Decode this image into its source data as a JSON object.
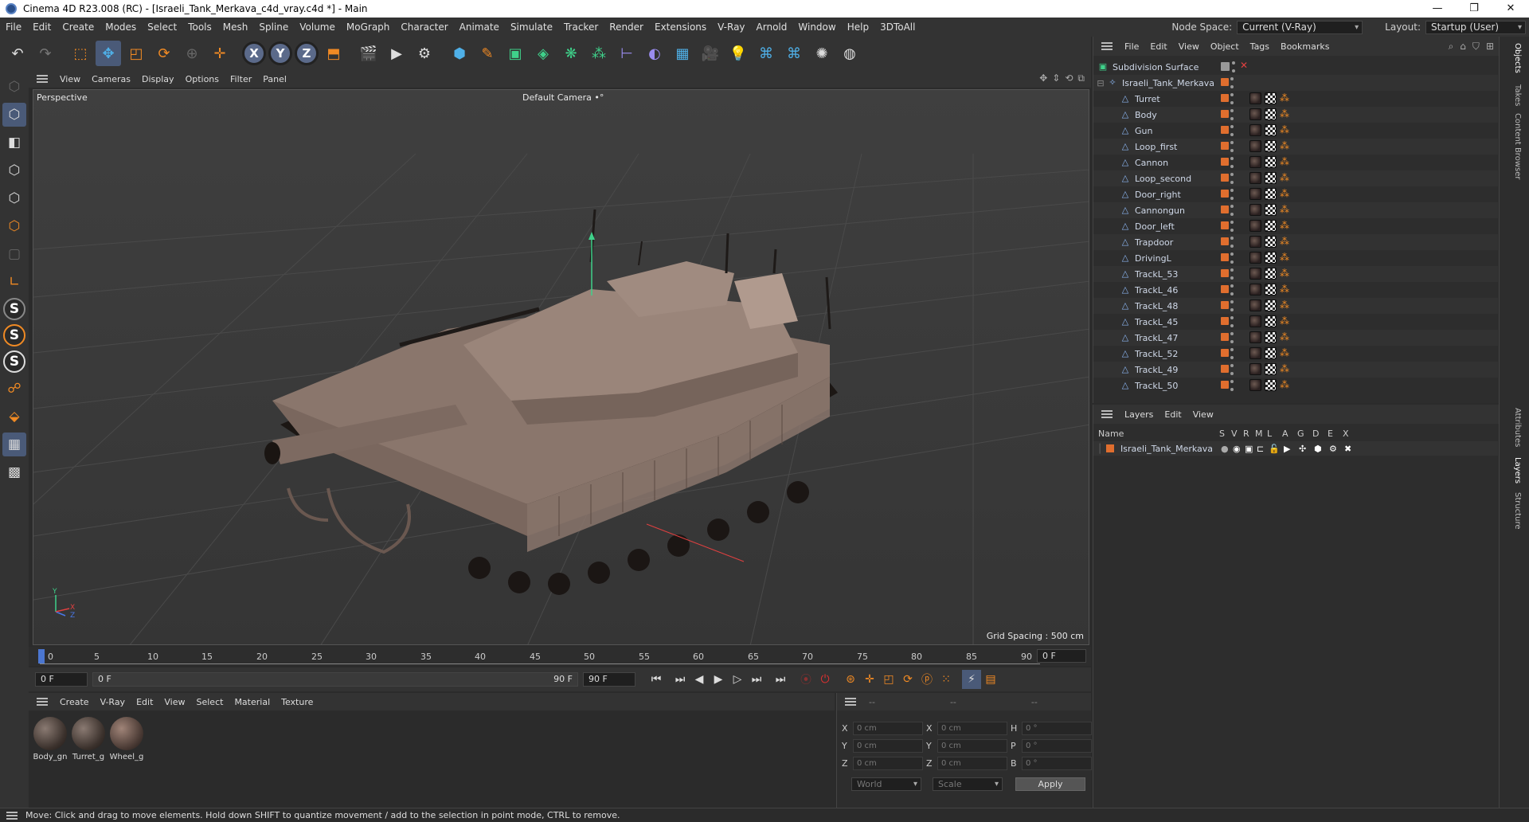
{
  "window": {
    "title": "Cinema 4D R23.008 (RC) - [Israeli_Tank_Merkava_c4d_vray.c4d *] - Main",
    "controls": [
      "—",
      "❐",
      "✕"
    ]
  },
  "menubar": {
    "items": [
      "File",
      "Edit",
      "Create",
      "Modes",
      "Select",
      "Tools",
      "Mesh",
      "Spline",
      "Volume",
      "MoGraph",
      "Character",
      "Animate",
      "Simulate",
      "Tracker",
      "Render",
      "Extensions",
      "V-Ray",
      "Arnold",
      "Window",
      "Help",
      "3DToAll"
    ],
    "node_space_label": "Node Space:",
    "node_space_value": "Current (V-Ray)",
    "layout_label": "Layout:",
    "layout_value": "Startup (User)"
  },
  "toolbar": {
    "x_label": "X",
    "y_label": "Y",
    "z_label": "Z"
  },
  "viewport": {
    "menu": [
      "View",
      "Cameras",
      "Display",
      "Options",
      "Filter",
      "Panel"
    ],
    "view_name": "Perspective",
    "camera_name": "Default Camera",
    "camera_mark": "•°",
    "grid_spacing": "Grid Spacing : 500 cm",
    "axis_y": "Y",
    "axis_z": "Z",
    "axis_x": "X"
  },
  "timeline": {
    "ticks": [
      "0",
      "5",
      "10",
      "15",
      "20",
      "25",
      "30",
      "35",
      "40",
      "45",
      "50",
      "55",
      "60",
      "65",
      "70",
      "75",
      "80",
      "85",
      "90"
    ],
    "current_frame": "0 F"
  },
  "transport": {
    "start_field": "0 F",
    "range_start": "0 F",
    "range_end": "90 F",
    "end_field": "90 F"
  },
  "materials": {
    "menu": [
      "Create",
      "V-Ray",
      "Edit",
      "View",
      "Select",
      "Material",
      "Texture"
    ],
    "items": [
      "Body_gn",
      "Turret_g",
      "Wheel_g"
    ]
  },
  "coordinates": {
    "head": [
      "--",
      "--",
      "--"
    ],
    "rows": [
      {
        "l1": "X",
        "v1": "0 cm",
        "l2": "X",
        "v2": "0 cm",
        "l3": "H",
        "v3": "0 °"
      },
      {
        "l1": "Y",
        "v1": "0 cm",
        "l2": "Y",
        "v2": "0 cm",
        "l3": "P",
        "v3": "0 °"
      },
      {
        "l1": "Z",
        "v1": "0 cm",
        "l2": "Z",
        "v2": "0 cm",
        "l3": "B",
        "v3": "0 °"
      }
    ],
    "world_option": "World",
    "scale_option": "Scale",
    "apply_label": "Apply"
  },
  "objects": {
    "menu": [
      "File",
      "Edit",
      "View",
      "Object",
      "Tags",
      "Bookmarks"
    ],
    "root": "Subdivision Surface",
    "group": "Israeli_Tank_Merkava",
    "children": [
      "Turret",
      "Body",
      "Gun",
      "Loop_first",
      "Cannon",
      "Loop_second",
      "Door_right",
      "Cannongun",
      "Door_left",
      "Trapdoor",
      "DrivingL",
      "TrackL_53",
      "TrackL_46",
      "TrackL_48",
      "TrackL_45",
      "TrackL_47",
      "TrackL_52",
      "TrackL_49",
      "TrackL_50"
    ]
  },
  "layers": {
    "menu": [
      "Layers",
      "Edit",
      "View"
    ],
    "columns": [
      "Name",
      "S",
      "V",
      "R",
      "M",
      "L",
      "A",
      "G",
      "D",
      "E",
      "X"
    ],
    "items": [
      "Israeli_Tank_Merkava"
    ]
  },
  "right_tabs": [
    "Objects",
    "Takes",
    "Content Browser",
    "Attributes",
    "Layers",
    "Structure"
  ],
  "status": "Move: Click and drag to move elements. Hold down SHIFT to quantize movement / add to the selection in point mode, CTRL to remove.",
  "colors": {
    "accent": "#f08a24",
    "selection": "#4a5a78",
    "tank": "#8a766c",
    "background": "#2b2b2b"
  }
}
